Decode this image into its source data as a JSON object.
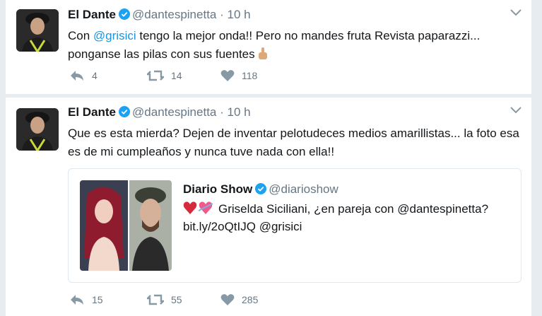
{
  "tweets": [
    {
      "name": "El Dante",
      "handle": "@dantespinetta",
      "separator": "·",
      "time": "10 h",
      "text_before": "Con ",
      "mention": "@grisici",
      "text_after": " tengo la mejor onda!! Pero no mandes fruta Revista paparazzi... ponganse las pilas con sus fuentes ",
      "emoji_icon": "middle-finger-emoji",
      "replies": "4",
      "retweets": "14",
      "likes": "118"
    },
    {
      "name": "El Dante",
      "handle": "@dantespinetta",
      "separator": "·",
      "time": "10 h",
      "text": "Que es esta mierda? Dejen de inventar pelotudeces medios amarillistas... la foto esa es de mi cumpleaños y nunca tuve nada con ella!!",
      "replies": "15",
      "retweets": "55",
      "likes": "285",
      "quote": {
        "name": "Diario Show",
        "handle": "@diarioshow",
        "text_before": "Griselda Siciliani, ¿en pareja con @dantespinetta? bit.ly/2oQtIJQ ",
        "mention": "@grisici"
      }
    }
  ],
  "colors": {
    "link": "#1b95e0",
    "secondary": "#657786",
    "verified": "#1da1f2",
    "background": "#e6ecf0"
  }
}
